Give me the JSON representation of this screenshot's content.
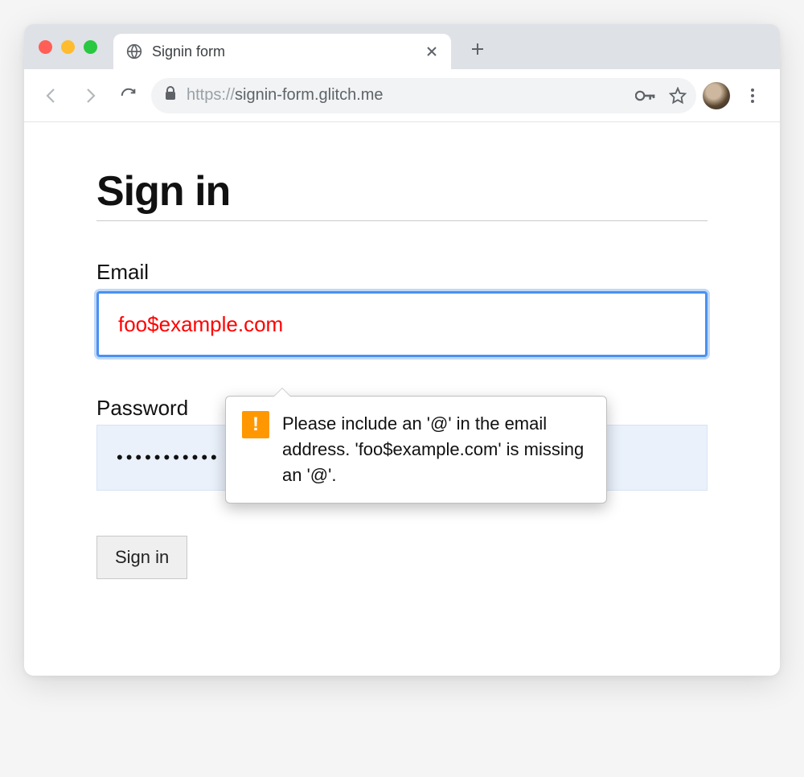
{
  "browser": {
    "tab_title": "Signin form",
    "url_proto": "https://",
    "url_rest": "signin-form.glitch.me"
  },
  "page": {
    "heading": "Sign in",
    "email_label": "Email",
    "email_value": "foo$example.com",
    "password_label": "Password",
    "password_masked": "•••••••••••",
    "submit_label": "Sign in"
  },
  "tooltip": {
    "message": "Please include an '@' in the email address. 'foo$example.com' is missing an '@'."
  }
}
